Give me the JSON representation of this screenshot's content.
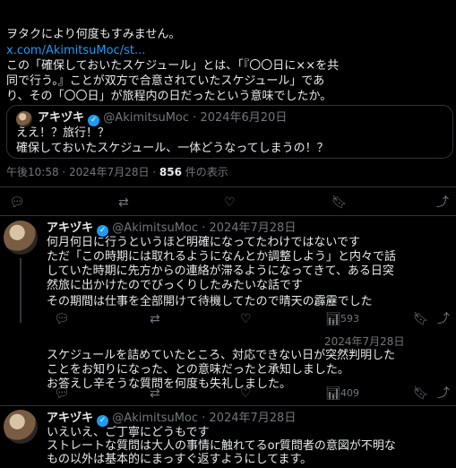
{
  "main_tweet": {
    "lines": [
      "ヲタクにより何度もすみません。",
      "x.com/AkimitsuMoc/st...",
      "この「確保しておいたスケジュール」とは、「『〇〇日に××を共",
      "同で行う。』ことが双方で合意されていたスケジュール」であ",
      "り、その「〇〇日」が旅程内の日だったという意味でしたか。"
    ],
    "meta_time": "午後10:58 · 2024年7月28日 · ",
    "meta_views_count": "856",
    "meta_views_label": " 件の表示"
  },
  "quote": {
    "name": "アキヅキ",
    "handle": "@AkimitsuMoc · 2024年6月20日",
    "lines": [
      "ええ！？旅行！？",
      "確保しておいたスケジュール、一体どうなってしまうの！？"
    ]
  },
  "reply1": {
    "name": "アキヅキ",
    "handle": "@AkimitsuMoc · 2024年7月28日",
    "lines": [
      "何月何日に行うというほど明確になってたわけではないです",
      "ただ「この時期には取れるようになんとか調整しよう」と内々で話",
      "していた時期に先方からの連絡が滞るようになってきて、ある日突",
      "然旅に出かけたのでびっくりしたみたいな話です",
      "",
      "その期間は仕事を全部開けて待機してたので晴天の霹靂でした"
    ],
    "likes": "593"
  },
  "reply2": {
    "date": "2024年7月28日",
    "lines": [
      "スケジュールを詰めていたところ、対応できない日が突然判明した",
      "ことをお知りになった、との意味だったと承知しました。",
      "お答えし辛そうな質問を何度も失礼しました。"
    ],
    "likes": "409"
  },
  "reply3": {
    "name": "アキヅキ",
    "handle": "@AkimitsuMoc · 2024年7月28日",
    "lines": [
      "いえいえ、ご丁寧にどうもです",
      "ストレートな質問は大人の事情に触れてるor質問者の意図が不明な",
      "もの以外は基本的にまっすぐ返すようにしてます。"
    ]
  },
  "icons": {
    "reply": "reply-icon",
    "retweet": "retweet-icon",
    "like": "heart-icon",
    "bookmark": "bookmark-icon",
    "share": "share-icon",
    "verified": "verified-badge-icon"
  }
}
